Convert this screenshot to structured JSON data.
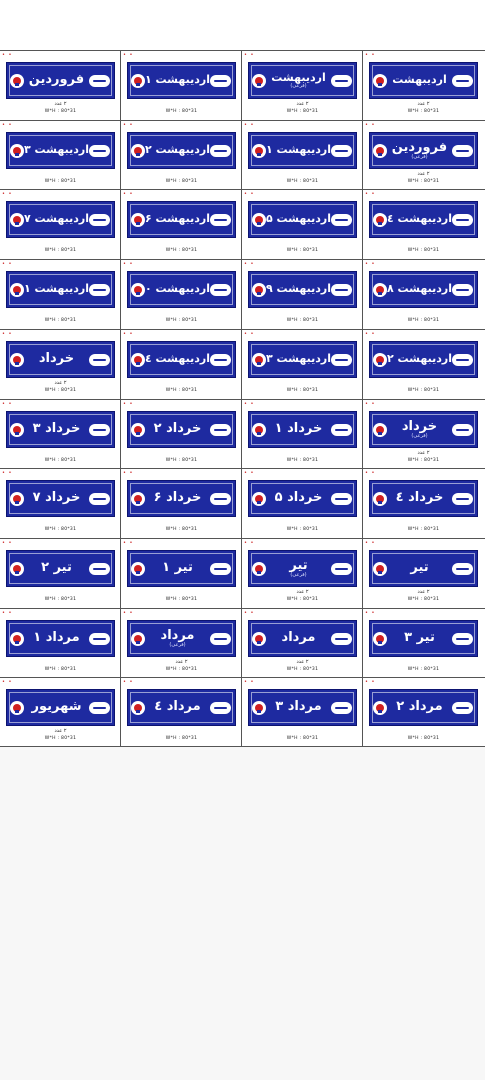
{
  "dimension_label": "W*H : 80*31",
  "rows": [
    [
      {
        "text": "اردیبهشت",
        "sub": "",
        "count": "۲ عدد"
      },
      {
        "text": "اردیبهشت",
        "sub": "(فرعی)",
        "count": "۲ عدد"
      },
      {
        "text": "اردیبهشت ۱",
        "sub": "",
        "count": ""
      },
      {
        "text": "فروردین",
        "sub": "",
        "count": "۲ عدد"
      }
    ],
    [
      {
        "text": "فروردین",
        "sub": "(فرعی)",
        "count": "۲ عدد"
      },
      {
        "text": "اردیبهشت ۱",
        "sub": "",
        "count": ""
      },
      {
        "text": "اردیبهشت ۲",
        "sub": "",
        "count": ""
      },
      {
        "text": "اردیبهشت ۳",
        "sub": "",
        "count": ""
      }
    ],
    [
      {
        "text": "اردیبهشت ٤",
        "sub": "",
        "count": ""
      },
      {
        "text": "اردیبهشت ۵",
        "sub": "",
        "count": ""
      },
      {
        "text": "اردیبهشت ۶",
        "sub": "",
        "count": ""
      },
      {
        "text": "اردیبهشت ۷",
        "sub": "",
        "count": ""
      }
    ],
    [
      {
        "text": "اردیبهشت ۸",
        "sub": "",
        "count": ""
      },
      {
        "text": "اردیبهشت ۹",
        "sub": "",
        "count": ""
      },
      {
        "text": "اردیبهشت ۱۰",
        "sub": "",
        "count": ""
      },
      {
        "text": "اردیبهشت ۱۱",
        "sub": "",
        "count": ""
      }
    ],
    [
      {
        "text": "اردیبهشت ۱۲",
        "sub": "",
        "count": ""
      },
      {
        "text": "اردیبهشت ۱۳",
        "sub": "",
        "count": ""
      },
      {
        "text": "اردیبهشت ١٤",
        "sub": "",
        "count": ""
      },
      {
        "text": "خرداد",
        "sub": "",
        "count": "۲ عدد"
      }
    ],
    [
      {
        "text": "خرداد",
        "sub": "(فرعی)",
        "count": "۲ عدد"
      },
      {
        "text": "خرداد ۱",
        "sub": "",
        "count": ""
      },
      {
        "text": "خرداد ۲",
        "sub": "",
        "count": ""
      },
      {
        "text": "خرداد ۳",
        "sub": "",
        "count": ""
      }
    ],
    [
      {
        "text": "خرداد ٤",
        "sub": "",
        "count": ""
      },
      {
        "text": "خرداد ۵",
        "sub": "",
        "count": ""
      },
      {
        "text": "خرداد ۶",
        "sub": "",
        "count": ""
      },
      {
        "text": "خرداد ۷",
        "sub": "",
        "count": ""
      }
    ],
    [
      {
        "text": "تیر",
        "sub": "",
        "count": "۲ عدد"
      },
      {
        "text": "تیر",
        "sub": "(فرعی)",
        "count": "۲ عدد"
      },
      {
        "text": "تیر ۱",
        "sub": "",
        "count": ""
      },
      {
        "text": "تیر ۲",
        "sub": "",
        "count": ""
      }
    ],
    [
      {
        "text": "تیر ۳",
        "sub": "",
        "count": ""
      },
      {
        "text": "مرداد",
        "sub": "",
        "count": "۲ عدد"
      },
      {
        "text": "مرداد",
        "sub": "(فرعی)",
        "count": "۲ عدد"
      },
      {
        "text": "مرداد ۱",
        "sub": "",
        "count": ""
      }
    ],
    [
      {
        "text": "مرداد ۲",
        "sub": "",
        "count": ""
      },
      {
        "text": "مرداد ۳",
        "sub": "",
        "count": ""
      },
      {
        "text": "مرداد ٤",
        "sub": "",
        "count": ""
      },
      {
        "text": "شهریور",
        "sub": "",
        "count": "۲ عدد"
      }
    ]
  ]
}
